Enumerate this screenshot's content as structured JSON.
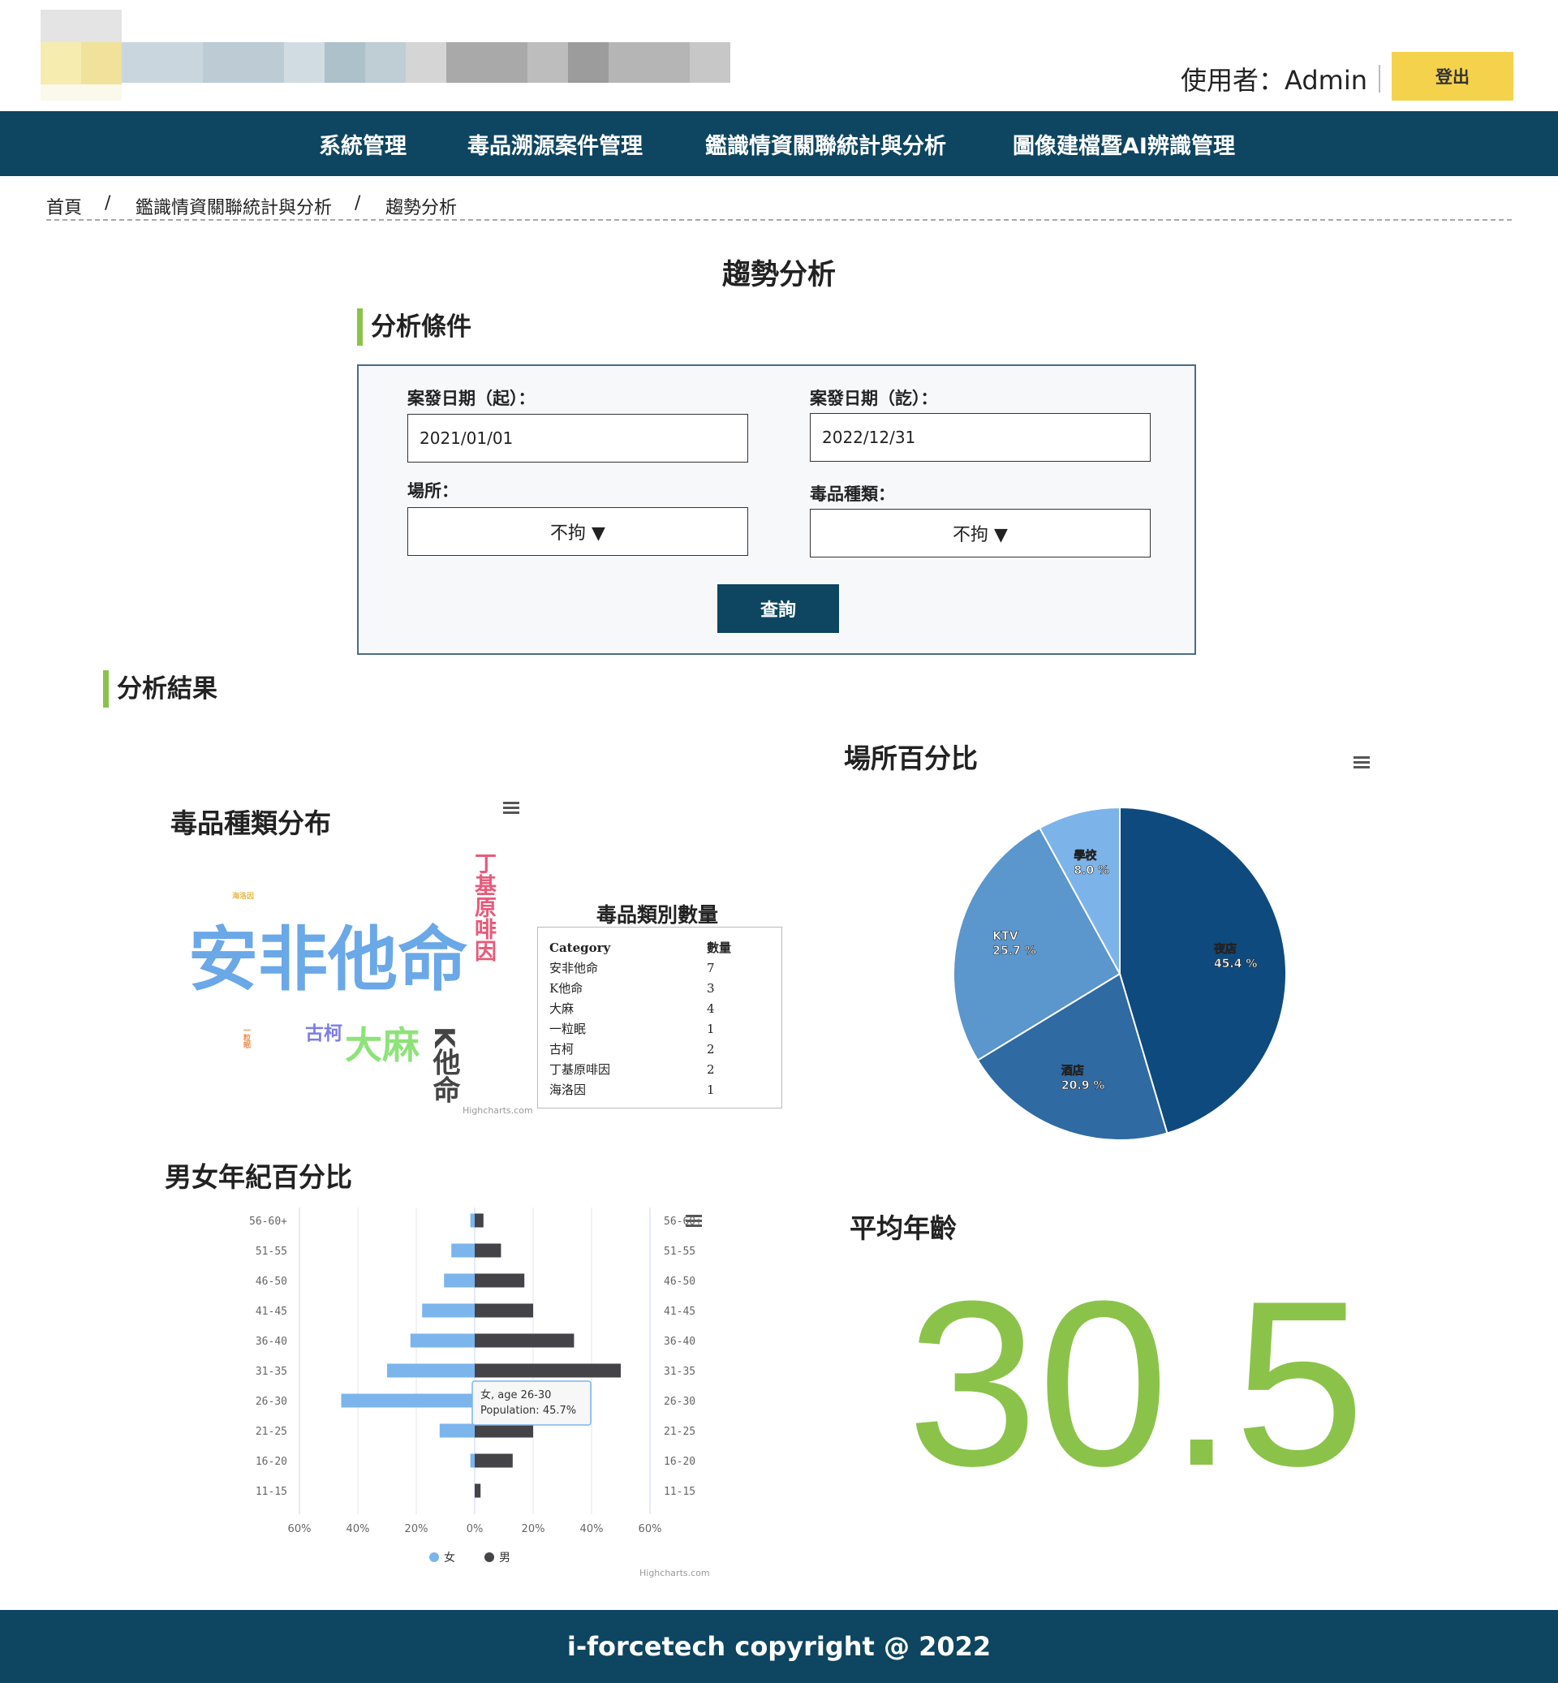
{
  "header": {
    "user_label": "使用者：Admin",
    "logout_label": "登出"
  },
  "nav": {
    "items": [
      "系統管理",
      "毒品溯源案件管理",
      "鑑識情資關聯統計與分析",
      "圖像建檔暨AI辨識管理"
    ]
  },
  "breadcrumb": {
    "items": [
      "首頁",
      "鑑識情資關聯統計與分析",
      "趨勢分析"
    ],
    "separator": "/"
  },
  "page_title": "趨勢分析",
  "conditions": {
    "section_title": "分析條件",
    "start_date": {
      "label": "案發日期（起）：",
      "value": "2021/01/01"
    },
    "end_date": {
      "label": "案發日期（訖）：",
      "value": "2022/12/31"
    },
    "place": {
      "label": "場所：",
      "selected": "不拘 ▼"
    },
    "drug_type": {
      "label": "毒品種類：",
      "selected": "不拘 ▼"
    },
    "query_label": "查詢"
  },
  "results": {
    "section_title": "分析結果"
  },
  "wordcloud": {
    "title": "毒品種類分布",
    "credits": "Highcharts.com",
    "words": [
      {
        "text": "安非他命",
        "color": "#6aa8e8"
      },
      {
        "text": "丁基原啡因",
        "color": "#e85a7a"
      },
      {
        "text": "大麻",
        "color": "#8ee27a"
      },
      {
        "text": "K他命",
        "color": "#444444"
      },
      {
        "text": "古柯",
        "color": "#7c7ce8"
      },
      {
        "text": "海洛因",
        "color": "#e8b84a"
      },
      {
        "text": "一粒眠",
        "color": "#f08c4a"
      }
    ]
  },
  "drug_table": {
    "title": "毒品類別數量",
    "headers": [
      "Category",
      "數量"
    ],
    "rows": [
      [
        "安非他命",
        "7"
      ],
      [
        "K他命",
        "3"
      ],
      [
        "大麻",
        "4"
      ],
      [
        "一粒眠",
        "1"
      ],
      [
        "古柯",
        "2"
      ],
      [
        "丁基原啡因",
        "2"
      ],
      [
        "海洛因",
        "1"
      ]
    ]
  },
  "pie": {
    "title": "場所百分比",
    "colors": {
      "nightclub": "#0e4a7e",
      "hotel": "#2f6aa3",
      "ktv": "#5b96cc",
      "school": "#7cb4ea"
    }
  },
  "pyramid": {
    "title": "男女年紀百分比",
    "tooltip_line1": "女, age 26-30",
    "tooltip_line2": "Population: 45.7%",
    "credits": "Highcharts.com",
    "x_ticks": [
      "60%",
      "40%",
      "20%",
      "0%",
      "20%",
      "40%",
      "60%"
    ]
  },
  "avg_age": {
    "title": "平均年齡",
    "value": "30.5"
  },
  "footer": {
    "text": "i-forcetech copyright @ 2022"
  },
  "chart_data": [
    {
      "type": "pie",
      "title": "場所百分比",
      "categories": [
        "夜店",
        "酒店",
        "KTV",
        "學校"
      ],
      "values": [
        45.4,
        20.9,
        25.7,
        8.0
      ],
      "value_labels": [
        "45.4 %",
        "20.9 %",
        "25.7 %",
        "8.0 %"
      ]
    },
    {
      "type": "bar",
      "title": "男女年紀百分比",
      "categories": [
        "56-60+",
        "51-55",
        "46-50",
        "41-45",
        "36-40",
        "31-35",
        "26-30",
        "21-25",
        "16-20",
        "11-15"
      ],
      "series": [
        {
          "name": "女",
          "color": "#7cb5ec",
          "values": [
            1.5,
            8,
            10.5,
            18,
            22,
            30,
            45.7,
            12,
            1.5,
            0
          ]
        },
        {
          "name": "男",
          "color": "#434348",
          "values": [
            3,
            9,
            17,
            20,
            34,
            50,
            39,
            20,
            13,
            2
          ]
        }
      ],
      "xlim": [
        -60,
        60
      ]
    }
  ]
}
